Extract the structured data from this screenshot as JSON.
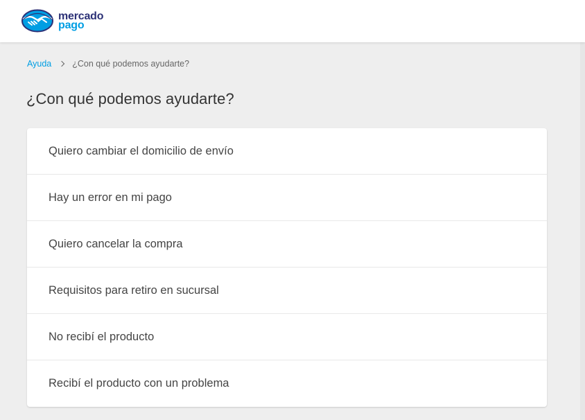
{
  "header": {
    "logo": {
      "icon": "handshake-icon",
      "line1": "mercado",
      "line2": "pago",
      "colors": {
        "navy": "#2d3277",
        "blue": "#009ee3"
      }
    }
  },
  "breadcrumb": {
    "root": "Ayuda",
    "current": "¿Con qué podemos ayudarte?"
  },
  "page": {
    "title": "¿Con qué podemos ayudarte?"
  },
  "help_options": [
    {
      "label": "Quiero cambiar el domicilio de envío"
    },
    {
      "label": "Hay un error en mi pago"
    },
    {
      "label": "Quiero cancelar la compra"
    },
    {
      "label": "Requisitos para retiro en sucursal"
    },
    {
      "label": "No recibí el producto"
    },
    {
      "label": "Recibí el producto con un problema"
    }
  ]
}
